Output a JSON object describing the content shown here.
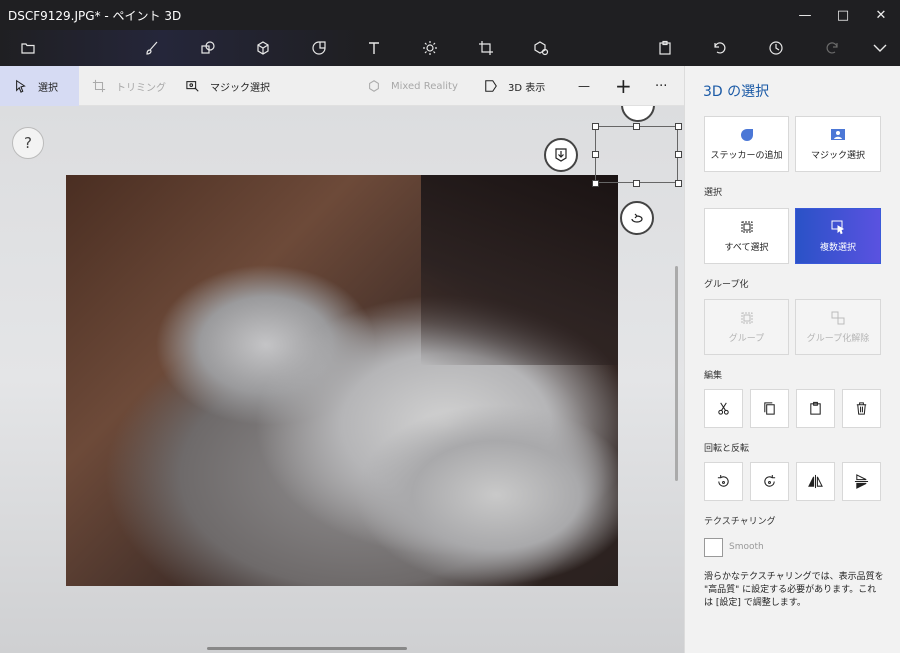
{
  "window": {
    "title": "DSCF9129.JPG* - ペイント 3D",
    "controls": [
      "minimize-icon",
      "maximize-icon",
      "close-icon"
    ]
  },
  "toolbar": {
    "items": [
      "menu-folder-icon",
      "brush-icon",
      "2d-shapes-icon",
      "3d-shapes-icon",
      "stickers-icon",
      "text-icon",
      "effects-icon",
      "canvas-icon",
      "3d-library-icon",
      "paste-icon",
      "undo-icon",
      "history-icon",
      "redo-icon",
      "expand-icon"
    ]
  },
  "subbar": {
    "select": "選択",
    "crop": "トリミング",
    "magic_select": "マジック選択",
    "mixed_reality": "Mixed Reality",
    "view3d": "3D 表示",
    "zoom_out": "—",
    "zoom_in": "+",
    "more": "···"
  },
  "canvas": {
    "help": "?"
  },
  "panel": {
    "title": "3D の選択",
    "sticker_add": "ステッカーの追加",
    "magic_select": "マジック選択",
    "selection_label": "選択",
    "select_all": "すべて選択",
    "multi_select": "複数選択",
    "group_label": "グループ化",
    "group": "グループ",
    "ungroup": "グループ化解除",
    "edit_label": "編集",
    "rotate_label": "回転と反転",
    "texturing_label": "テクスチャリング",
    "smooth": "Smooth",
    "note": "滑らかなテクスチャリングでは、表示品質を \"高品質\" に設定する必要があります。これは [設定] で調整します。"
  },
  "colors": {
    "accent": "#1b5aa6",
    "primary_button": "#3a5ad8",
    "titlebar": "#1f1f22"
  }
}
